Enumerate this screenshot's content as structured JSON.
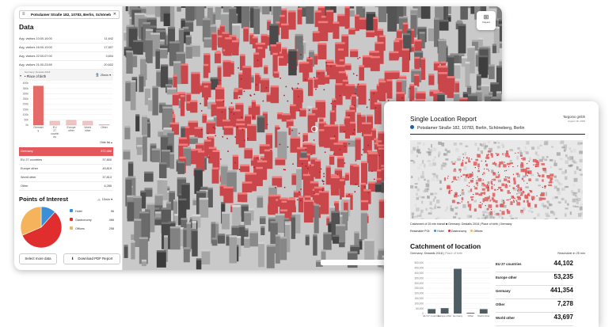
{
  "search": {
    "value": "Potsdamer Straße 182, 10783, Berlin, Schöneb"
  },
  "data_section": {
    "title": "Data",
    "rows": [
      {
        "label": "Avg. visitors 10:00-16:00",
        "value": "11,642"
      },
      {
        "label": "Avg. visitors 16:00-19:00",
        "value": "17,507"
      },
      {
        "label": "Avg. visitors 22:00-07:00",
        "value": "3,604"
      },
      {
        "label": "Avg. visitors 21:00-23:59",
        "value": "20,602"
      }
    ]
  },
  "chart_header": {
    "subtitle": "Germany: Destatis 2018",
    "label": "Place of birth",
    "time_select": "25min"
  },
  "chart_data": {
    "type": "bar",
    "categories": [
      "Germany",
      "EU 27 countries",
      "Europe other",
      "World other",
      "Other"
    ],
    "tick_labels": [
      "German y",
      "EU 27 countri es",
      "Europe other",
      "World other",
      "Other"
    ],
    "values": [
      372466,
      37800,
      45819,
      37813,
      6285
    ],
    "ylim": [
      0,
      400000
    ],
    "yticks": [
      "400k",
      "350k",
      "300k",
      "250k",
      "200k",
      "150k",
      "100k",
      "50k",
      "0k"
    ],
    "colors": {
      "bar": "#e66a6a",
      "highlight": "#e3585c"
    }
  },
  "hide_list_label": "Hide list",
  "list": [
    {
      "label": "Germany",
      "value": "372,466",
      "highlight": true
    },
    {
      "label": "EU 27 countries",
      "value": "37,800",
      "highlight": false
    },
    {
      "label": "Europe other",
      "value": "45,819",
      "highlight": false
    },
    {
      "label": "World other",
      "value": "37,813",
      "highlight": false
    },
    {
      "label": "Other",
      "value": "6,285",
      "highlight": false
    }
  ],
  "poi": {
    "title": "Points of Interest",
    "select": "15min",
    "items": [
      {
        "label": "Hotel",
        "value": "96",
        "color": "#3b8fd6"
      },
      {
        "label": "Gastronomy",
        "value": "466",
        "color": "#e02d2d"
      },
      {
        "label": "Offices",
        "value": "258",
        "color": "#f5b45c"
      }
    ]
  },
  "buttons": {
    "select_more": "Select more data",
    "download": "Download PDF Report"
  },
  "map": {
    "inspect_label": "Inspect",
    "scale_label": "Germany",
    "zoom_label": "100"
  },
  "report": {
    "title": "Single Location Report",
    "company": "Targomo gmbh",
    "date": "August 18, 2020",
    "address": "Potsdamer Straße 182, 10783, Berlin, Schöneberg, Berlin",
    "legend_line1": "Catchment of 25 min transit ■ Germany: Destatis 2018 | Place of birth | Germany",
    "legend_reachable": "Reachable POI:",
    "legend_pois": [
      "Hotel",
      "Gastronomy",
      "Offices"
    ],
    "section_title": "Catchment of location",
    "meta_main": "Germany: Destatis 2018",
    "meta_sub": "Place of birth",
    "reachable": "Reachable in 25 min",
    "chart_yticks": [
      "500,000",
      "450,000",
      "400,000",
      "350,000",
      "300,000",
      "250,000",
      "200,000",
      "150,000",
      "100,000",
      "50,000",
      "0"
    ],
    "chart_categories": [
      "EU 27 countries",
      "Europe other",
      "Germany",
      "Other",
      "World other"
    ],
    "chart_values": [
      44102,
      53235,
      441354,
      7278,
      43697
    ],
    "chart_ylim": [
      0,
      500000
    ],
    "rows": [
      {
        "label": "EU 27 countries",
        "value": "44,102"
      },
      {
        "label": "Europe other",
        "value": "53,235"
      },
      {
        "label": "Germany",
        "value": "441,354"
      },
      {
        "label": "Other",
        "value": "7,278"
      },
      {
        "label": "World other",
        "value": "43,697"
      }
    ],
    "bar_color": "#4d5d63"
  }
}
